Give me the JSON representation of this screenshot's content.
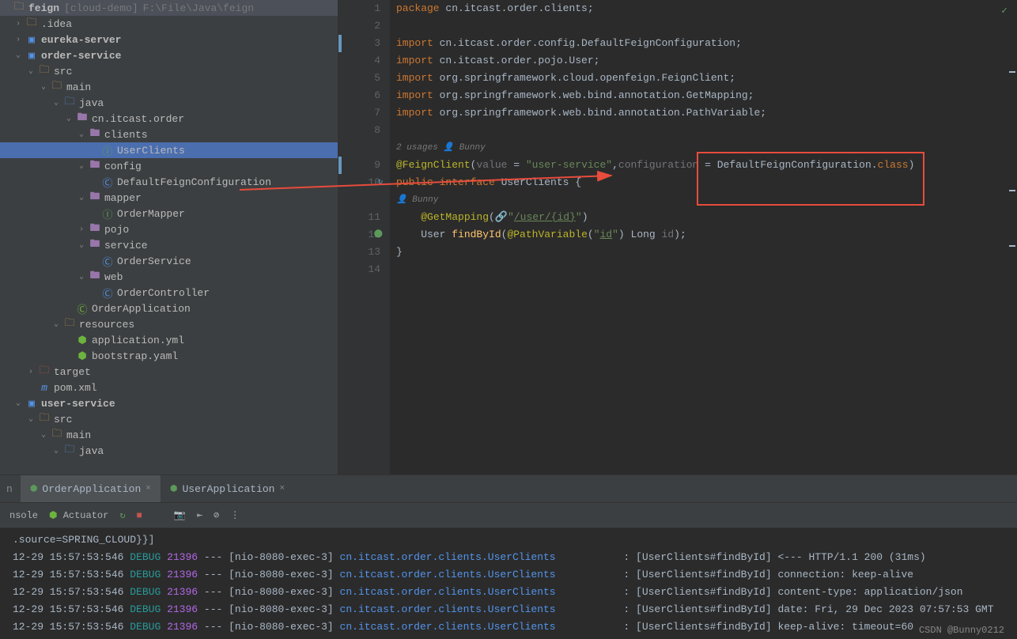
{
  "project": {
    "root": "feign",
    "module_hint": "[cloud-demo]",
    "path_hint": "F:\\File\\Java\\feign",
    "tree": [
      {
        "depth": 0,
        "chevron": "",
        "icon": "folder",
        "label": "feign",
        "bold": true,
        "selected": false,
        "extra": "[cloud-demo]",
        "hint": "F:\\File\\Java\\feign"
      },
      {
        "depth": 1,
        "chevron": ">",
        "icon": "folder",
        "label": ".idea"
      },
      {
        "depth": 1,
        "chevron": ">",
        "icon": "module",
        "label": "eureka-server",
        "bold": true
      },
      {
        "depth": 1,
        "chevron": "v",
        "icon": "module",
        "label": "order-service",
        "bold": true
      },
      {
        "depth": 2,
        "chevron": "v",
        "icon": "folder",
        "label": "src"
      },
      {
        "depth": 3,
        "chevron": "v",
        "icon": "folder",
        "label": "main"
      },
      {
        "depth": 4,
        "chevron": "v",
        "icon": "src-folder",
        "label": "java"
      },
      {
        "depth": 5,
        "chevron": "v",
        "icon": "package",
        "label": "cn.itcast.order"
      },
      {
        "depth": 6,
        "chevron": "v",
        "icon": "package",
        "label": "clients"
      },
      {
        "depth": 7,
        "chevron": "",
        "icon": "interface",
        "label": "UserClients",
        "selected": true
      },
      {
        "depth": 6,
        "chevron": "v",
        "icon": "package",
        "label": "config"
      },
      {
        "depth": 7,
        "chevron": "",
        "icon": "class",
        "label": "DefaultFeignConfiguration"
      },
      {
        "depth": 6,
        "chevron": "v",
        "icon": "package",
        "label": "mapper"
      },
      {
        "depth": 7,
        "chevron": "",
        "icon": "interface",
        "label": "OrderMapper"
      },
      {
        "depth": 6,
        "chevron": ">",
        "icon": "package",
        "label": "pojo"
      },
      {
        "depth": 6,
        "chevron": "v",
        "icon": "package",
        "label": "service"
      },
      {
        "depth": 7,
        "chevron": "",
        "icon": "class",
        "label": "OrderService"
      },
      {
        "depth": 6,
        "chevron": "v",
        "icon": "package",
        "label": "web"
      },
      {
        "depth": 7,
        "chevron": "",
        "icon": "class",
        "label": "OrderController"
      },
      {
        "depth": 5,
        "chevron": "",
        "icon": "spring-class",
        "label": "OrderApplication"
      },
      {
        "depth": 4,
        "chevron": "v",
        "icon": "res-folder",
        "label": "resources"
      },
      {
        "depth": 5,
        "chevron": "",
        "icon": "yaml",
        "label": "application.yml"
      },
      {
        "depth": 5,
        "chevron": "",
        "icon": "yaml",
        "label": "bootstrap.yaml"
      },
      {
        "depth": 2,
        "chevron": ">",
        "icon": "excluded",
        "label": "target"
      },
      {
        "depth": 2,
        "chevron": "",
        "icon": "maven",
        "label": "pom.xml"
      },
      {
        "depth": 1,
        "chevron": "v",
        "icon": "module",
        "label": "user-service",
        "bold": true
      },
      {
        "depth": 2,
        "chevron": "v",
        "icon": "folder",
        "label": "src"
      },
      {
        "depth": 3,
        "chevron": "v",
        "icon": "folder",
        "label": "main"
      },
      {
        "depth": 4,
        "chevron": "v",
        "icon": "src-folder",
        "label": "java"
      }
    ]
  },
  "editor": {
    "lines": [
      {
        "n": 1,
        "tokens": [
          {
            "c": "k-keyword",
            "t": "package "
          },
          {
            "c": "",
            "t": "cn.itcast.order.clients;"
          }
        ]
      },
      {
        "n": 2,
        "tokens": []
      },
      {
        "n": 3,
        "modified": true,
        "tokens": [
          {
            "c": "k-keyword",
            "t": "import "
          },
          {
            "c": "",
            "t": "cn.itcast.order.config.DefaultFeignConfiguration;"
          }
        ]
      },
      {
        "n": 4,
        "tokens": [
          {
            "c": "k-keyword",
            "t": "import "
          },
          {
            "c": "",
            "t": "cn.itcast.order.pojo.User;"
          }
        ]
      },
      {
        "n": 5,
        "tokens": [
          {
            "c": "k-keyword",
            "t": "import "
          },
          {
            "c": "",
            "t": "org.springframework.cloud.openfeign.FeignClient;"
          }
        ]
      },
      {
        "n": 6,
        "tokens": [
          {
            "c": "k-keyword",
            "t": "import "
          },
          {
            "c": "",
            "t": "org.springframework.web.bind.annotation.GetMapping;"
          }
        ]
      },
      {
        "n": 7,
        "tokens": [
          {
            "c": "k-keyword",
            "t": "import "
          },
          {
            "c": "",
            "t": "org.springframework.web.bind.annotation.PathVariable;"
          }
        ]
      },
      {
        "n": 8,
        "tokens": []
      },
      {
        "n": "",
        "hint": "2 usages   👤 Bunny"
      },
      {
        "n": 9,
        "modified": true,
        "tokens": [
          {
            "c": "k-annotation",
            "t": "@FeignClient"
          },
          {
            "c": "",
            "t": "("
          },
          {
            "c": "k-param",
            "t": "value"
          },
          {
            "c": "",
            "t": " = "
          },
          {
            "c": "k-string",
            "t": "\"user-service\""
          },
          {
            "c": "",
            "t": ","
          },
          {
            "c": "k-param",
            "t": "configuration"
          },
          {
            "c": "",
            "t": " = DefaultFeignConfiguration."
          },
          {
            "c": "k-keyword",
            "t": "class"
          },
          {
            "c": "",
            "t": ")"
          }
        ]
      },
      {
        "n": 10,
        "gicon": "↻",
        "tokens": [
          {
            "c": "k-keyword",
            "t": "public interface "
          },
          {
            "c": "k-class",
            "t": "UserClients"
          },
          {
            "c": "",
            "t": " {"
          }
        ]
      },
      {
        "n": "",
        "hint": "      👤 Bunny"
      },
      {
        "n": 11,
        "tokens": [
          {
            "c": "",
            "t": "    "
          },
          {
            "c": "k-annotation",
            "t": "@GetMapping"
          },
          {
            "c": "",
            "t": "(🔗"
          },
          {
            "c": "k-string",
            "t": "\""
          },
          {
            "c": "k-string k-underline",
            "t": "/user/{id}"
          },
          {
            "c": "k-string",
            "t": "\""
          },
          {
            "c": "",
            "t": ")"
          }
        ]
      },
      {
        "n": 12,
        "gicon": "⬤",
        "tokens": [
          {
            "c": "",
            "t": "    User "
          },
          {
            "c": "k-method",
            "t": "findById"
          },
          {
            "c": "",
            "t": "("
          },
          {
            "c": "k-annotation",
            "t": "@PathVariable"
          },
          {
            "c": "",
            "t": "("
          },
          {
            "c": "k-string",
            "t": "\""
          },
          {
            "c": "k-string k-underline",
            "t": "id"
          },
          {
            "c": "k-string",
            "t": "\""
          },
          {
            "c": "",
            "t": ") Long "
          },
          {
            "c": "k-param",
            "t": "id"
          },
          {
            "c": "",
            "t": ");"
          }
        ]
      },
      {
        "n": 13,
        "tokens": [
          {
            "c": "",
            "t": "}"
          }
        ]
      },
      {
        "n": 14,
        "tokens": []
      }
    ]
  },
  "run_tabs": [
    {
      "label": "OrderApplication",
      "active": true
    },
    {
      "label": "UserApplication",
      "active": false
    }
  ],
  "toolbar": {
    "console": "nsole",
    "actuator": "Actuator"
  },
  "console": {
    "lines": [
      {
        "msg_only": ".source=SPRING_CLOUD}}]"
      },
      {
        "time": "12-29 15:57:53:546",
        "level": "DEBUG",
        "pid": "21396",
        "thread": "[nio-8080-exec-3]",
        "logger": "cn.itcast.order.clients.UserClients",
        "msg": "[UserClients#findById] <--- HTTP/1.1 200 (31ms)"
      },
      {
        "time": "12-29 15:57:53:546",
        "level": "DEBUG",
        "pid": "21396",
        "thread": "[nio-8080-exec-3]",
        "logger": "cn.itcast.order.clients.UserClients",
        "msg": "[UserClients#findById] connection: keep-alive"
      },
      {
        "time": "12-29 15:57:53:546",
        "level": "DEBUG",
        "pid": "21396",
        "thread": "[nio-8080-exec-3]",
        "logger": "cn.itcast.order.clients.UserClients",
        "msg": "[UserClients#findById] content-type: application/json"
      },
      {
        "time": "12-29 15:57:53:546",
        "level": "DEBUG",
        "pid": "21396",
        "thread": "[nio-8080-exec-3]",
        "logger": "cn.itcast.order.clients.UserClients",
        "msg": "[UserClients#findById] date: Fri, 29 Dec 2023 07:57:53 GMT"
      },
      {
        "time": "12-29 15:57:53:546",
        "level": "DEBUG",
        "pid": "21396",
        "thread": "[nio-8080-exec-3]",
        "logger": "cn.itcast.order.clients.UserClients",
        "msg": "[UserClients#findById] keep-alive: timeout=60"
      }
    ]
  },
  "watermark": "CSDN @Bunny0212"
}
